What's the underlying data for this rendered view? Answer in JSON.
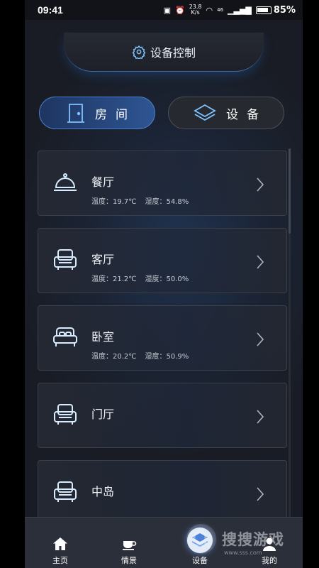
{
  "status": {
    "time": "09:41",
    "net_speed_top": "23.8",
    "net_speed_bottom": "K/s",
    "signal": "46",
    "battery": "85%"
  },
  "header": {
    "title": "设备控制",
    "icon": "gear-icon"
  },
  "tabs": [
    {
      "label": "房间",
      "icon": "door-icon",
      "active": true
    },
    {
      "label": "设备",
      "icon": "layers-icon",
      "active": false
    }
  ],
  "rooms": [
    {
      "name": "餐厅",
      "icon": "food-cover-icon",
      "temp": "温度：19.7℃",
      "humidity": "湿度：54.8%"
    },
    {
      "name": "客厅",
      "icon": "armchair-icon",
      "temp": "温度：21.2℃",
      "humidity": "湿度：50.0%"
    },
    {
      "name": "卧室",
      "icon": "bed-icon",
      "temp": "温度：20.2℃",
      "humidity": "湿度：50.9%"
    },
    {
      "name": "门厅",
      "icon": "armchair-icon"
    },
    {
      "name": "中岛",
      "icon": "armchair-icon"
    }
  ],
  "nav": [
    {
      "label": "主页",
      "icon": "home-icon"
    },
    {
      "label": "情景",
      "icon": "cup-icon"
    },
    {
      "label": "设备",
      "icon": "layers-icon",
      "active": true
    },
    {
      "label": "我的",
      "icon": "user-icon"
    }
  ],
  "watermark": {
    "text": "搜搜游戏",
    "sub": "www.sss.com"
  },
  "colors": {
    "accent": "#3e6aa8",
    "icon_glow": "#cfe6ff",
    "active_tab": "#2e5593"
  }
}
